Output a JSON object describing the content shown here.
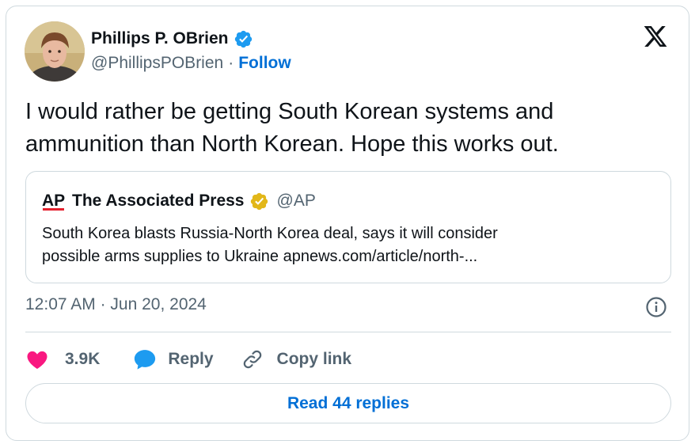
{
  "author": {
    "name": "Phillips P. OBrien",
    "handle": "@PhillipsPOBrien",
    "separator": "·",
    "follow_label": "Follow"
  },
  "tweet": {
    "text_line1": "I would rather be getting South Korean systems and",
    "text_line2": "ammunition than North Korean. Hope this works out."
  },
  "quote": {
    "logo_text": "AP",
    "name": "The Associated Press",
    "handle": "@AP",
    "text_line1": "South Korea blasts Russia-North Korea deal, says it will consider",
    "text_line2": "possible arms supplies to Ukraine apnews.com/article/north-..."
  },
  "meta": {
    "time": "12:07 AM",
    "separator": "·",
    "date": "Jun 20, 2024"
  },
  "actions": {
    "likes": "3.9K",
    "reply_label": "Reply",
    "copy_label": "Copy link"
  },
  "read_replies_label": "Read 44 replies",
  "colors": {
    "link_blue": "#006fd6",
    "verified_blue": "#1d9bf0",
    "verified_gold": "#e2b719",
    "heart_pink": "#f91880",
    "muted_text": "#536471",
    "border": "#cfd9de"
  },
  "icons": [
    "verified-badge-icon",
    "x-logo-icon",
    "gold-verified-badge-icon",
    "info-icon",
    "heart-icon",
    "reply-bubble-icon",
    "link-icon"
  ]
}
